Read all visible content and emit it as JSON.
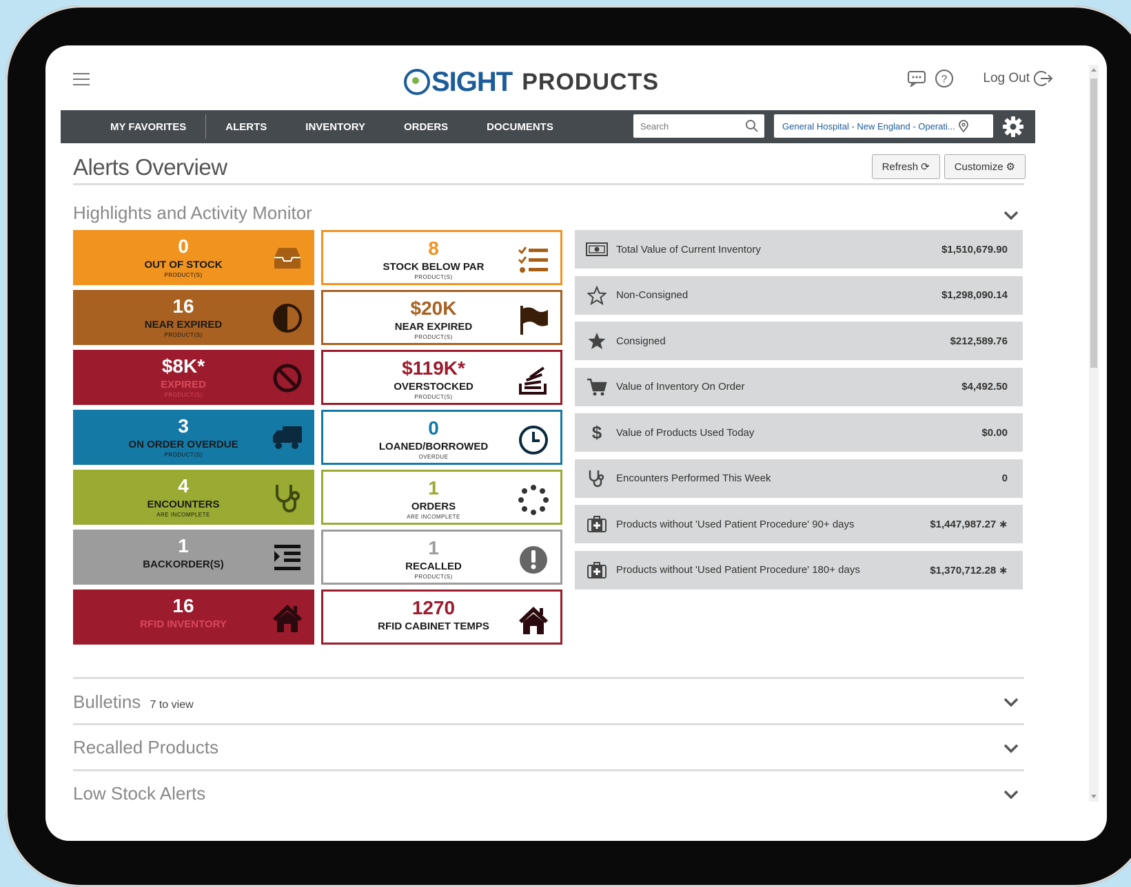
{
  "header": {
    "logo_main": "SIGHT",
    "logo_product": "PRODUCTS",
    "logout_label": "Log Out"
  },
  "nav": {
    "items": [
      "MY FAVORITES",
      "ALERTS",
      "INVENTORY",
      "ORDERS",
      "DOCUMENTS"
    ],
    "search_placeholder": "Search",
    "location": "General Hospital - New England - Operati..."
  },
  "page": {
    "title": "Alerts Overview",
    "refresh_label": "Refresh",
    "customize_label": "Customize"
  },
  "highlights": {
    "title": "Highlights and Activity Monitor",
    "tiles_left": [
      {
        "value": "0",
        "label": "OUT OF STOCK",
        "sub": "PRODUCT(S)",
        "color": "#f0931f",
        "icon": "inbox-icon"
      },
      {
        "value": "16",
        "label": "NEAR EXPIRED",
        "sub": "PRODUCT(S)",
        "color": "#a86121",
        "icon": "half-circle-icon"
      },
      {
        "value": "$8K*",
        "label": "EXPIRED",
        "sub": "PRODUCT(S)",
        "color": "#9c1b2c",
        "icon": "ban-icon"
      },
      {
        "value": "3",
        "label": "ON ORDER OVERDUE",
        "sub": "PRODUCT(S)",
        "color": "#1479a5",
        "icon": "truck-icon"
      },
      {
        "value": "4",
        "label": "ENCOUNTERS",
        "sub": "ARE INCOMPLETE",
        "color": "#9aaa32",
        "icon": "stethoscope-icon"
      },
      {
        "value": "1",
        "label": "BACKORDER(S)",
        "sub": "",
        "color": "#9c9c9c",
        "icon": "indent-list-icon"
      },
      {
        "value": "16",
        "label": "RFID INVENTORY",
        "sub": "",
        "color": "#9c1b2c",
        "icon": "home-icon"
      }
    ],
    "tiles_right": [
      {
        "value": "8",
        "label": "STOCK BELOW PAR",
        "sub": "PRODUCT(S)",
        "color": "#f0931f",
        "icon": "checklist-icon"
      },
      {
        "value": "$20K",
        "label": "NEAR EXPIRED",
        "sub": "PRODUCT(S)",
        "color": "#a86121",
        "icon": "flag-icon"
      },
      {
        "value": "$119K*",
        "label": "OVERSTOCKED",
        "sub": "PRODUCT(S)",
        "color": "#9c1b2c",
        "icon": "stack-icon"
      },
      {
        "value": "0",
        "label": "LOANED/BORROWED",
        "sub": "OVERDUE",
        "color": "#1479a5",
        "icon": "clock-icon"
      },
      {
        "value": "1",
        "label": "ORDERS",
        "sub": "ARE INCOMPLETE",
        "color": "#9aaa32",
        "icon": "spinner-icon"
      },
      {
        "value": "1",
        "label": "RECALLED",
        "sub": "PRODUCT(S)",
        "color": "#9c9c9c",
        "icon": "exclamation-icon"
      },
      {
        "value": "1270",
        "label": "RFID CABINET TEMPS",
        "sub": "",
        "color": "#9c1b2c",
        "icon": "home-icon"
      }
    ],
    "stats": [
      {
        "label": "Total Value of Current Inventory",
        "value": "$1,510,679.90",
        "icon": "money-icon"
      },
      {
        "label": "Non-Consigned",
        "value": "$1,298,090.14",
        "icon": "star-outline-icon"
      },
      {
        "label": "Consigned",
        "value": "$212,589.76",
        "icon": "star-filled-icon"
      },
      {
        "label": "Value of Inventory On Order",
        "value": "$4,492.50",
        "icon": "cart-icon"
      },
      {
        "label": "Value of Products Used Today",
        "value": "$0.00",
        "icon": "dollar-icon"
      },
      {
        "label": "Encounters Performed This Week",
        "value": "0",
        "icon": "stethoscope-icon"
      },
      {
        "label": "Products without 'Used Patient Procedure' 90+ days",
        "value": "$1,447,987.27 ∗",
        "icon": "medkit-icon"
      },
      {
        "label": "Products without 'Used Patient Procedure' 180+ days",
        "value": "$1,370,712.28 ∗",
        "icon": "medkit-icon"
      }
    ]
  },
  "sections": {
    "bulletins_title": "Bulletins",
    "bulletins_count": "7 to view",
    "recalled_title": "Recalled Products",
    "lowstock_title": "Low Stock Alerts"
  }
}
